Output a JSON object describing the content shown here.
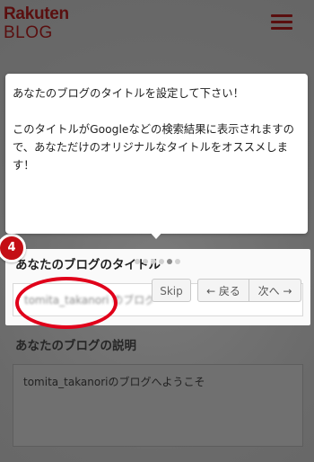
{
  "header": {
    "logo_top": "Rakuten",
    "logo_bottom": "BLOG",
    "menu_icon": "hamburger-menu-icon"
  },
  "tour": {
    "line1": "あなたのブログのタイトルを設定して下さい！",
    "line2": "このタイトルがGoogleなどの検索結果に表示されますので、あなただけのオリジナルなタイトルをオススメします！",
    "step_count": 6,
    "current_step_index": 4,
    "skip_label": "Skip",
    "back_label": "← 戻る",
    "next_label": "次へ →",
    "step_number": "4"
  },
  "form": {
    "title_label": "あなたのブログのタイトル",
    "title_value": "tomita_takanori のブログ",
    "description_label": "あなたのブログの説明",
    "description_value": "tomita_takanoriのブログへようこそ"
  },
  "colors": {
    "brand": "#5a0f0f",
    "badge": "#c40e15",
    "annotation_circle": "#e0001a"
  }
}
